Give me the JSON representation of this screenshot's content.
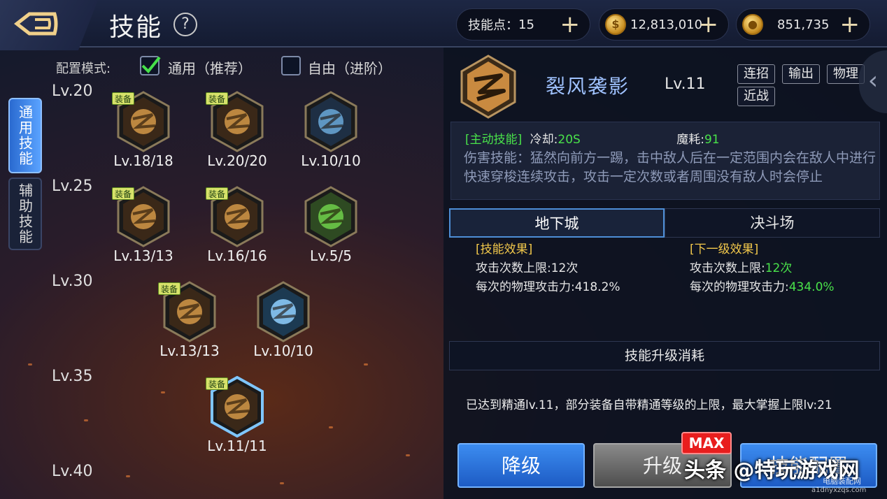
{
  "header": {
    "title": "技能",
    "help": "?",
    "skill_points_label": "技能点：",
    "skill_points": "15",
    "gold": "12,813,010",
    "bound_gold": "851,735",
    "plus": "+"
  },
  "side_tabs": {
    "general": "通用技能",
    "assist": "辅助技能"
  },
  "config": {
    "label": "配置模式:",
    "option_general": "通用（推荐）",
    "option_free": "自由（进阶）",
    "general_checked": true,
    "free_checked": false
  },
  "levels": [
    "Lv.20",
    "Lv.25",
    "Lv.30",
    "Lv.35",
    "Lv.40"
  ],
  "equip_tag": "装备",
  "skills": [
    {
      "level": "Lv.18/18",
      "equipped": true,
      "icon": "fist-burst-icon"
    },
    {
      "level": "Lv.20/20",
      "equipped": true,
      "icon": "spinning-fist-icon"
    },
    {
      "level": "Lv.10/10",
      "equipped": false,
      "icon": "body-aura-icon"
    },
    {
      "level": "Lv.13/13",
      "equipped": true,
      "icon": "palm-strike-icon"
    },
    {
      "level": "Lv.16/16",
      "equipped": true,
      "icon": "whirl-kick-icon"
    },
    {
      "level": "Lv.5/5",
      "equipped": false,
      "icon": "green-figure-icon"
    },
    {
      "level": "Lv.13/13",
      "equipped": true,
      "icon": "flame-swirl-icon"
    },
    {
      "level": "Lv.10/10",
      "equipped": false,
      "icon": "ice-fist-icon"
    },
    {
      "level": "Lv.11/11",
      "equipped": true,
      "icon": "lightning-kick-icon"
    }
  ],
  "detail": {
    "name": "裂风袭影",
    "level": "Lv.11",
    "tags": [
      "连招",
      "输出",
      "物理",
      "近战"
    ],
    "type": "[主动技能]",
    "cooldown_label": "冷却:",
    "cooldown": "20S",
    "mp_label": "魔耗:",
    "mp": "91",
    "description": "伤害技能：猛然向前方一踢，击中敌人后在一定范围内会在敌人中进行快速穿梭连续攻击，攻击一定次数或者周围没有敌人时会停止"
  },
  "mode_tabs": {
    "dungeon": "地下城",
    "arena": "决斗场"
  },
  "effects": {
    "current_title": "[技能效果]",
    "next_title": "[下一级效果]",
    "hits_label": "攻击次数上限:",
    "hits_current": "12次",
    "hits_next": "12次",
    "atk_label": "每次的物理攻击力:",
    "atk_current": "418.2%",
    "atk_next": "434.0%"
  },
  "cost": {
    "title": "技能升级消耗",
    "note": "已达到精通lv.11，部分装备自带精通等级的上限，最大掌握上限lv:21"
  },
  "buttons": {
    "down": "降级",
    "up": "升级",
    "config": "技能配置",
    "max": "MAX"
  },
  "watermark": {
    "main": "头条 @特玩游戏网",
    "small": "电脑装配网",
    "url": "a1dnyxzqs.com"
  },
  "colors": {
    "accent_blue": "#3c8cf0",
    "green": "#49e24a",
    "gold": "#f2c84b"
  }
}
